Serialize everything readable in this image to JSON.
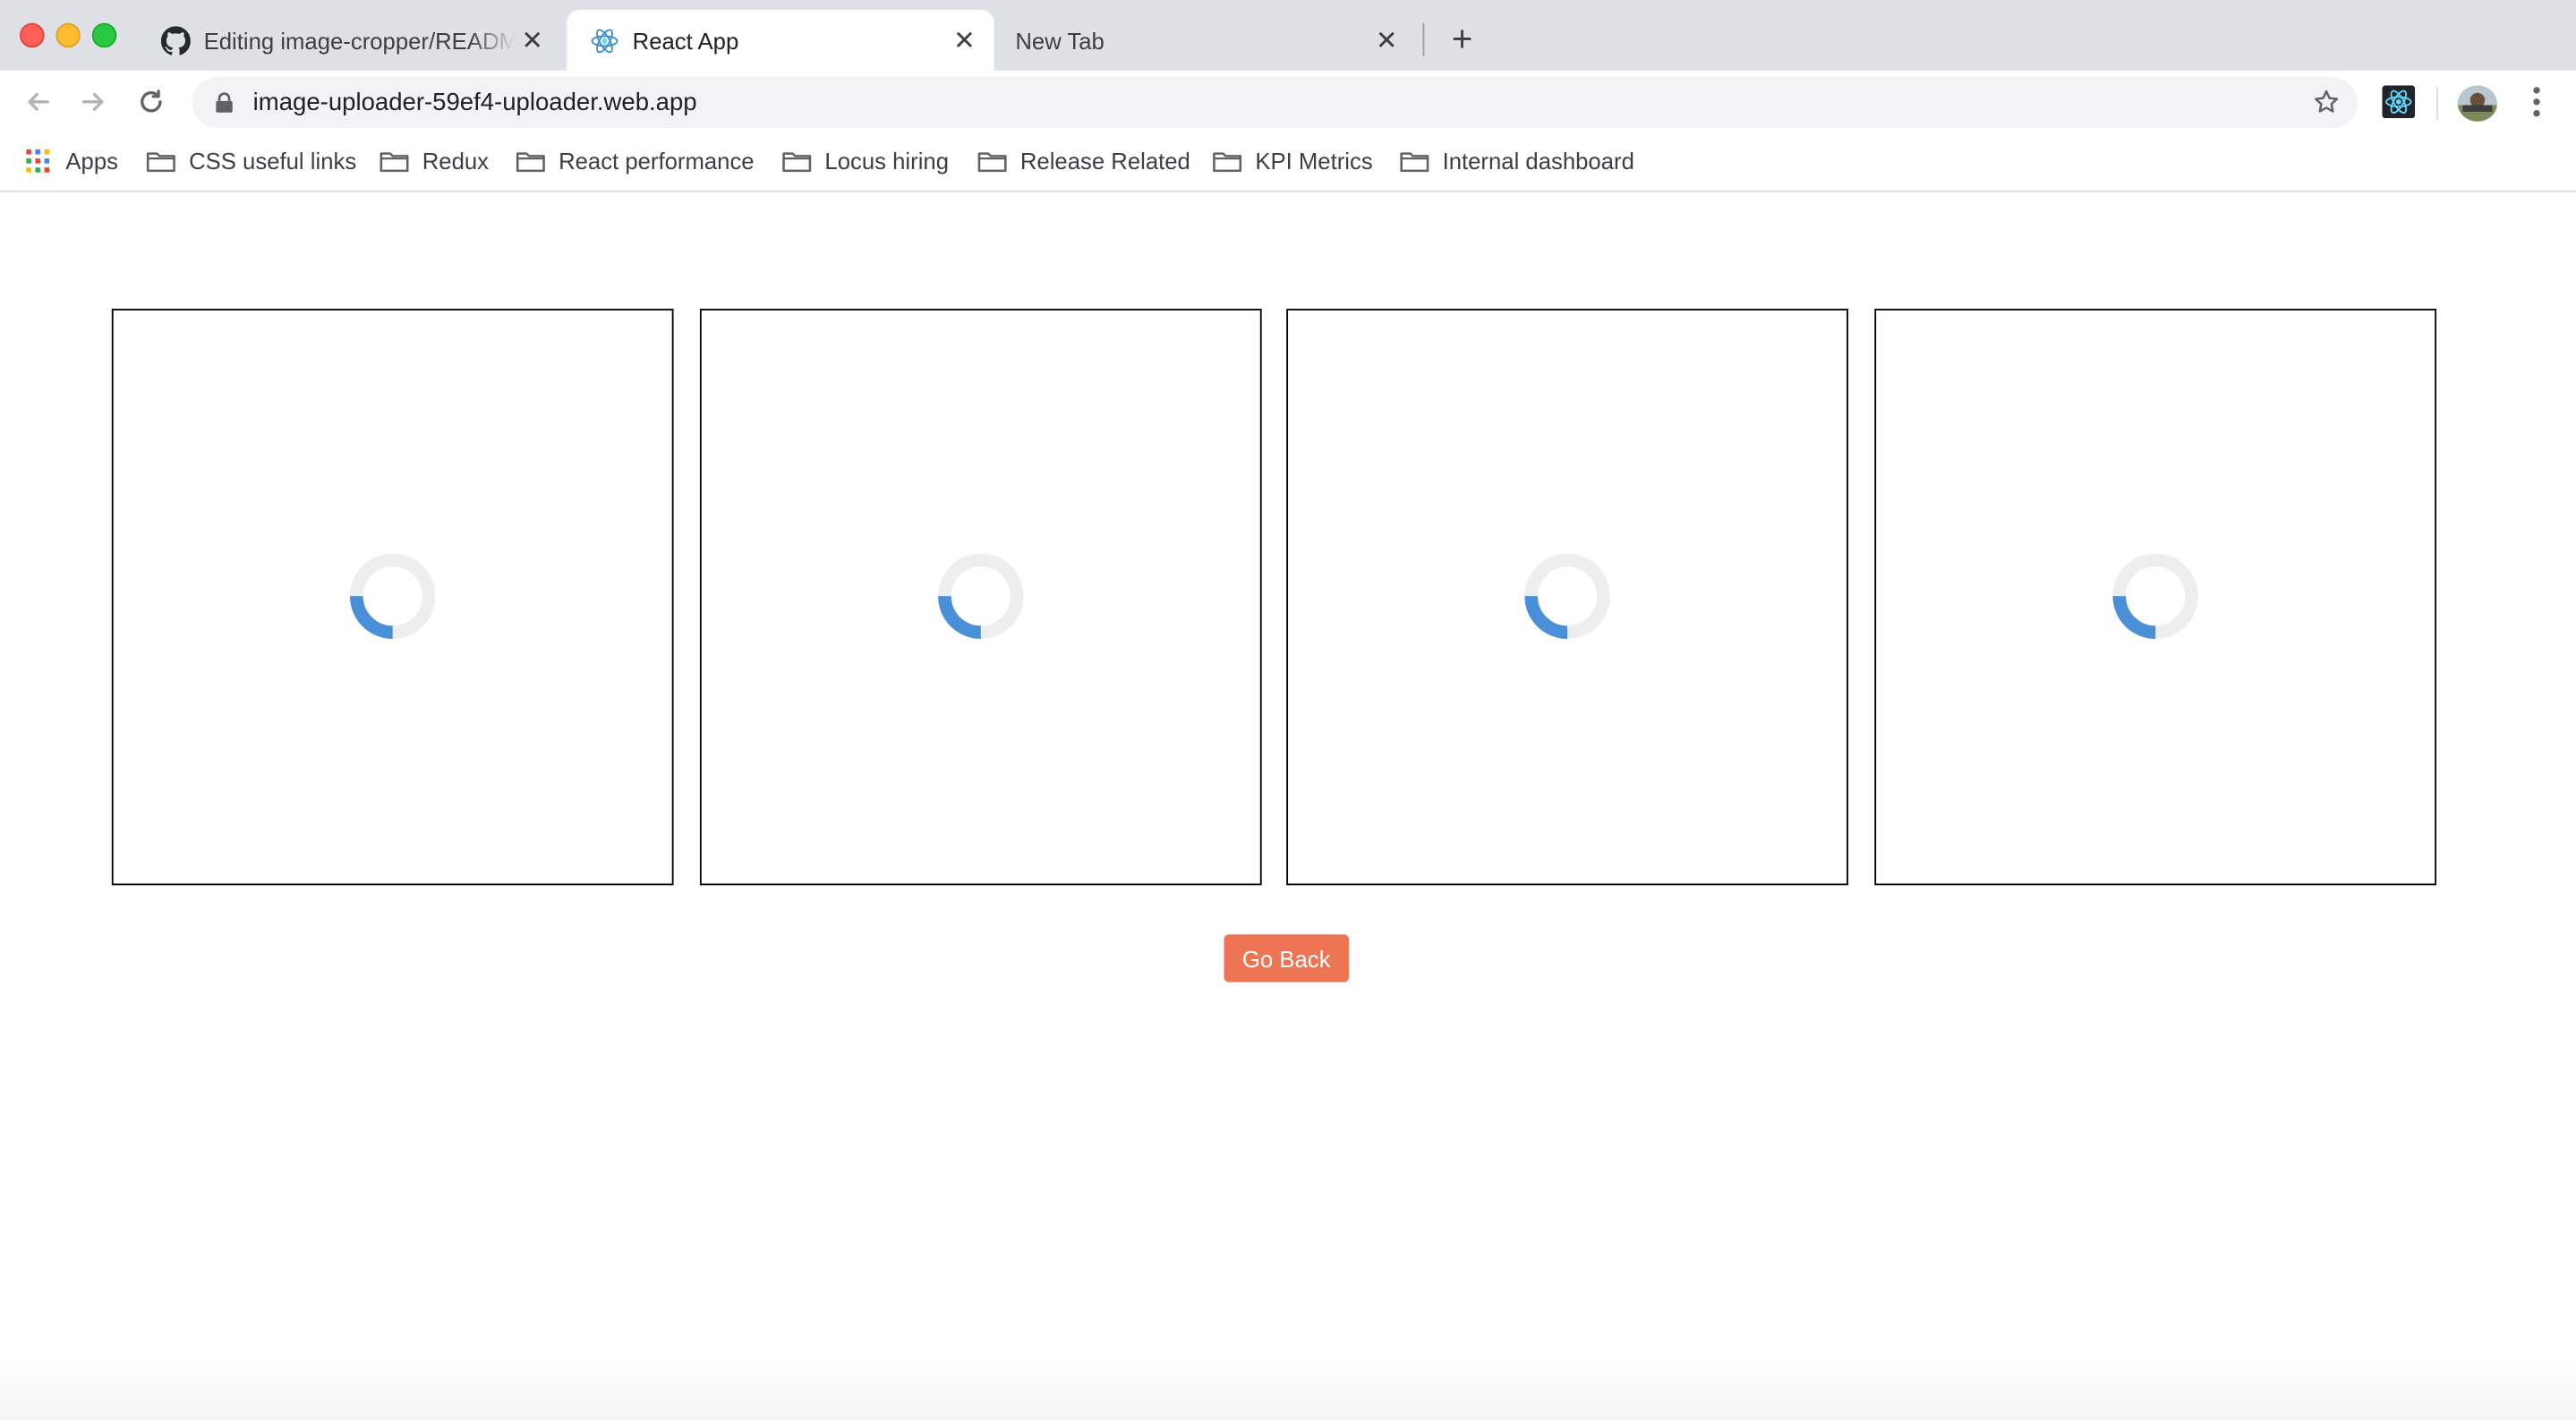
{
  "tabs": [
    {
      "title": "Editing image-cropper/README.md",
      "favicon": "github-icon"
    },
    {
      "title": "React App",
      "favicon": "react-icon",
      "active": true
    },
    {
      "title": "New Tab",
      "favicon": null
    }
  ],
  "toolbar": {
    "url": "image-uploader-59ef4-uploader.web.app"
  },
  "bookmarks": {
    "apps_label": "Apps",
    "items": [
      {
        "label": "CSS useful links"
      },
      {
        "label": "Redux"
      },
      {
        "label": "React performance"
      },
      {
        "label": "Locus hiring"
      },
      {
        "label": "Release Related"
      },
      {
        "label": "KPI Metrics"
      },
      {
        "label": "Internal dashboard"
      }
    ]
  },
  "content": {
    "image_slots": [
      {
        "state": "loading",
        "progress": 0.25
      },
      {
        "state": "loading",
        "progress": 0.25
      },
      {
        "state": "loading",
        "progress": 0.25
      },
      {
        "state": "loading",
        "progress": 0.25
      }
    ],
    "go_back_label": "Go Back"
  },
  "colors": {
    "accent_button": "#ed7554",
    "spinner_active": "#4a90d9",
    "spinner_track": "#eeeeee",
    "tabstrip_bg": "#dee1e6"
  }
}
